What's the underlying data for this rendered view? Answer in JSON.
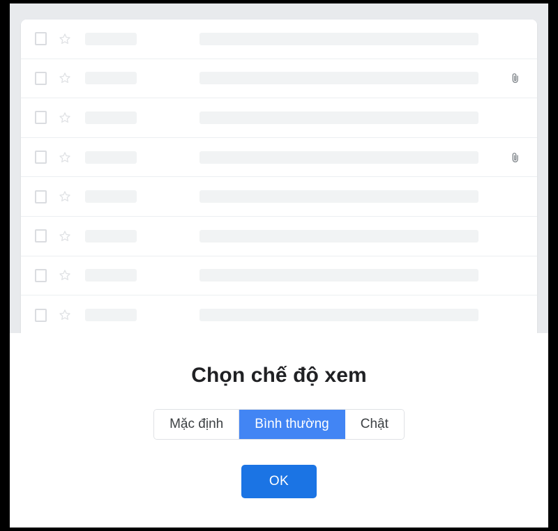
{
  "mail_list": {
    "panel_name": "email-list-panel",
    "rows": [
      {
        "checkbox": "unchecked",
        "star": "unstarred",
        "sender_placeholder": "",
        "subject_placeholder": "",
        "attachment": false
      },
      {
        "checkbox": "unchecked",
        "star": "unstarred",
        "sender_placeholder": "",
        "subject_placeholder": "",
        "attachment": true
      },
      {
        "checkbox": "unchecked",
        "star": "unstarred",
        "sender_placeholder": "",
        "subject_placeholder": "",
        "attachment": false
      },
      {
        "checkbox": "unchecked",
        "star": "unstarred",
        "sender_placeholder": "",
        "subject_placeholder": "",
        "attachment": true
      },
      {
        "checkbox": "unchecked",
        "star": "unstarred",
        "sender_placeholder": "",
        "subject_placeholder": "",
        "attachment": false
      },
      {
        "checkbox": "unchecked",
        "star": "unstarred",
        "sender_placeholder": "",
        "subject_placeholder": "",
        "attachment": false
      },
      {
        "checkbox": "unchecked",
        "star": "unstarred",
        "sender_placeholder": "",
        "subject_placeholder": "",
        "attachment": false
      },
      {
        "checkbox": "unchecked",
        "star": "unstarred",
        "sender_placeholder": "",
        "subject_placeholder": "",
        "attachment": false
      }
    ]
  },
  "dialog": {
    "title": "Chọn chế độ xem",
    "density_options": [
      {
        "label": "Mặc định",
        "selected": false
      },
      {
        "label": "Bình thường",
        "selected": true
      },
      {
        "label": "Chật",
        "selected": false
      }
    ],
    "confirm_label": "OK"
  },
  "colors": {
    "accent_selected": "#4285f4",
    "accent_button": "#1b74e4",
    "title_text": "#202124",
    "segment_text": "#3c4043",
    "segment_border": "#dfe1e5",
    "placeholder_bar": "#f1f3f4",
    "row_divider": "#eceff1",
    "list_backdrop": "#e8eaed",
    "frame": "#000000"
  },
  "icons": {
    "checkbox": "checkbox-icon",
    "star": "star-icon",
    "attachment": "paperclip-icon"
  }
}
